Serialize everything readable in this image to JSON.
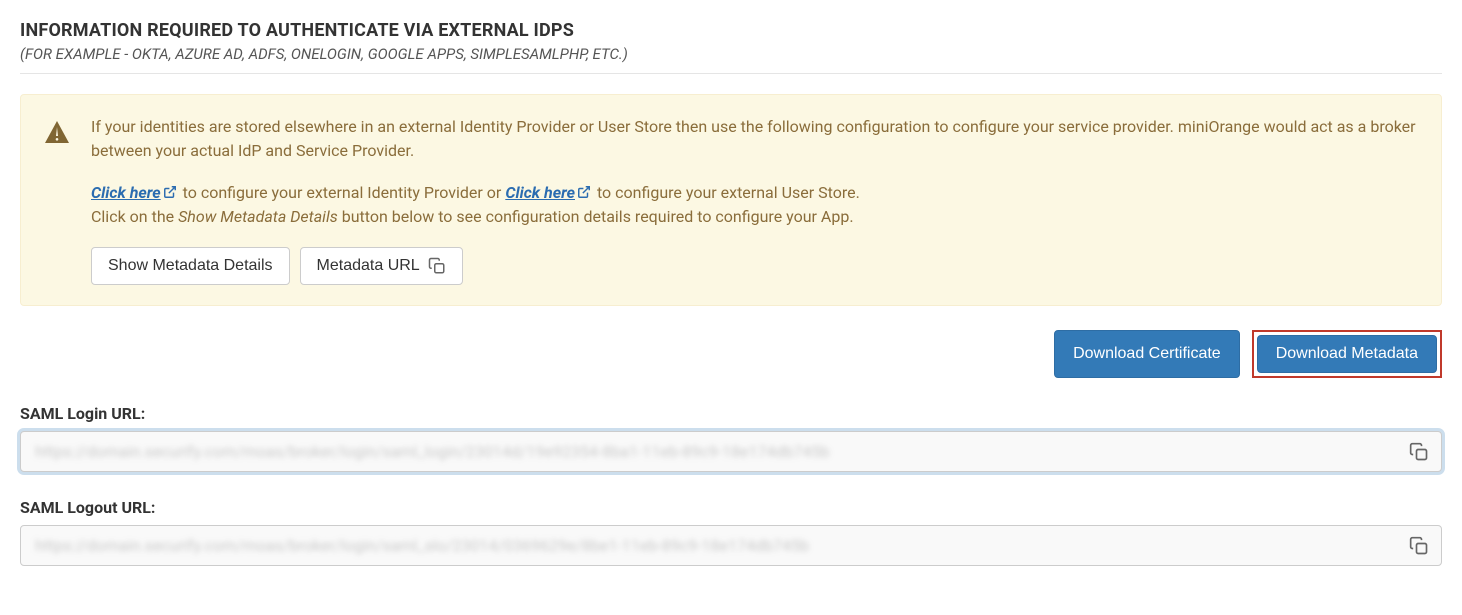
{
  "header": {
    "title": "INFORMATION REQUIRED TO AUTHENTICATE VIA EXTERNAL IDPS",
    "subtitle": "(FOR EXAMPLE - OKTA, AZURE AD, ADFS, ONELOGIN, GOOGLE APPS, SIMPLESAMLPHP, ETC.)"
  },
  "alert": {
    "line1": "If your identities are stored elsewhere in an external Identity Provider or User Store then use the following configuration to configure your service provider. miniOrange would act as a broker between your actual IdP and Service Provider.",
    "click_here_1": "Click here",
    "between_links_1": " to configure your external Identity Provider or ",
    "click_here_2": "Click here",
    "after_link_2": " to configure your external User Store.",
    "line3_pre": "Click on the ",
    "line3_italic": "Show Metadata Details",
    "line3_post": " button below to see configuration details required to configure your App.",
    "btn_show_metadata": "Show Metadata Details",
    "btn_metadata_url": "Metadata URL"
  },
  "buttons": {
    "download_certificate": "Download Certificate",
    "download_metadata": "Download Metadata"
  },
  "fields": {
    "saml_login_label": "SAML Login URL:",
    "saml_login_value": "https://domain.securify.com/moas/broker/login/saml_login/23014d/19e92354-8ba1-11eb-89c9-18e174db745b",
    "saml_logout_label": "SAML Logout URL:",
    "saml_logout_value": "https://domain.securify.com/moas/broker/login/saml_slo/23014/0369629e/8be1-11eb-89c9-18e174db745b"
  }
}
